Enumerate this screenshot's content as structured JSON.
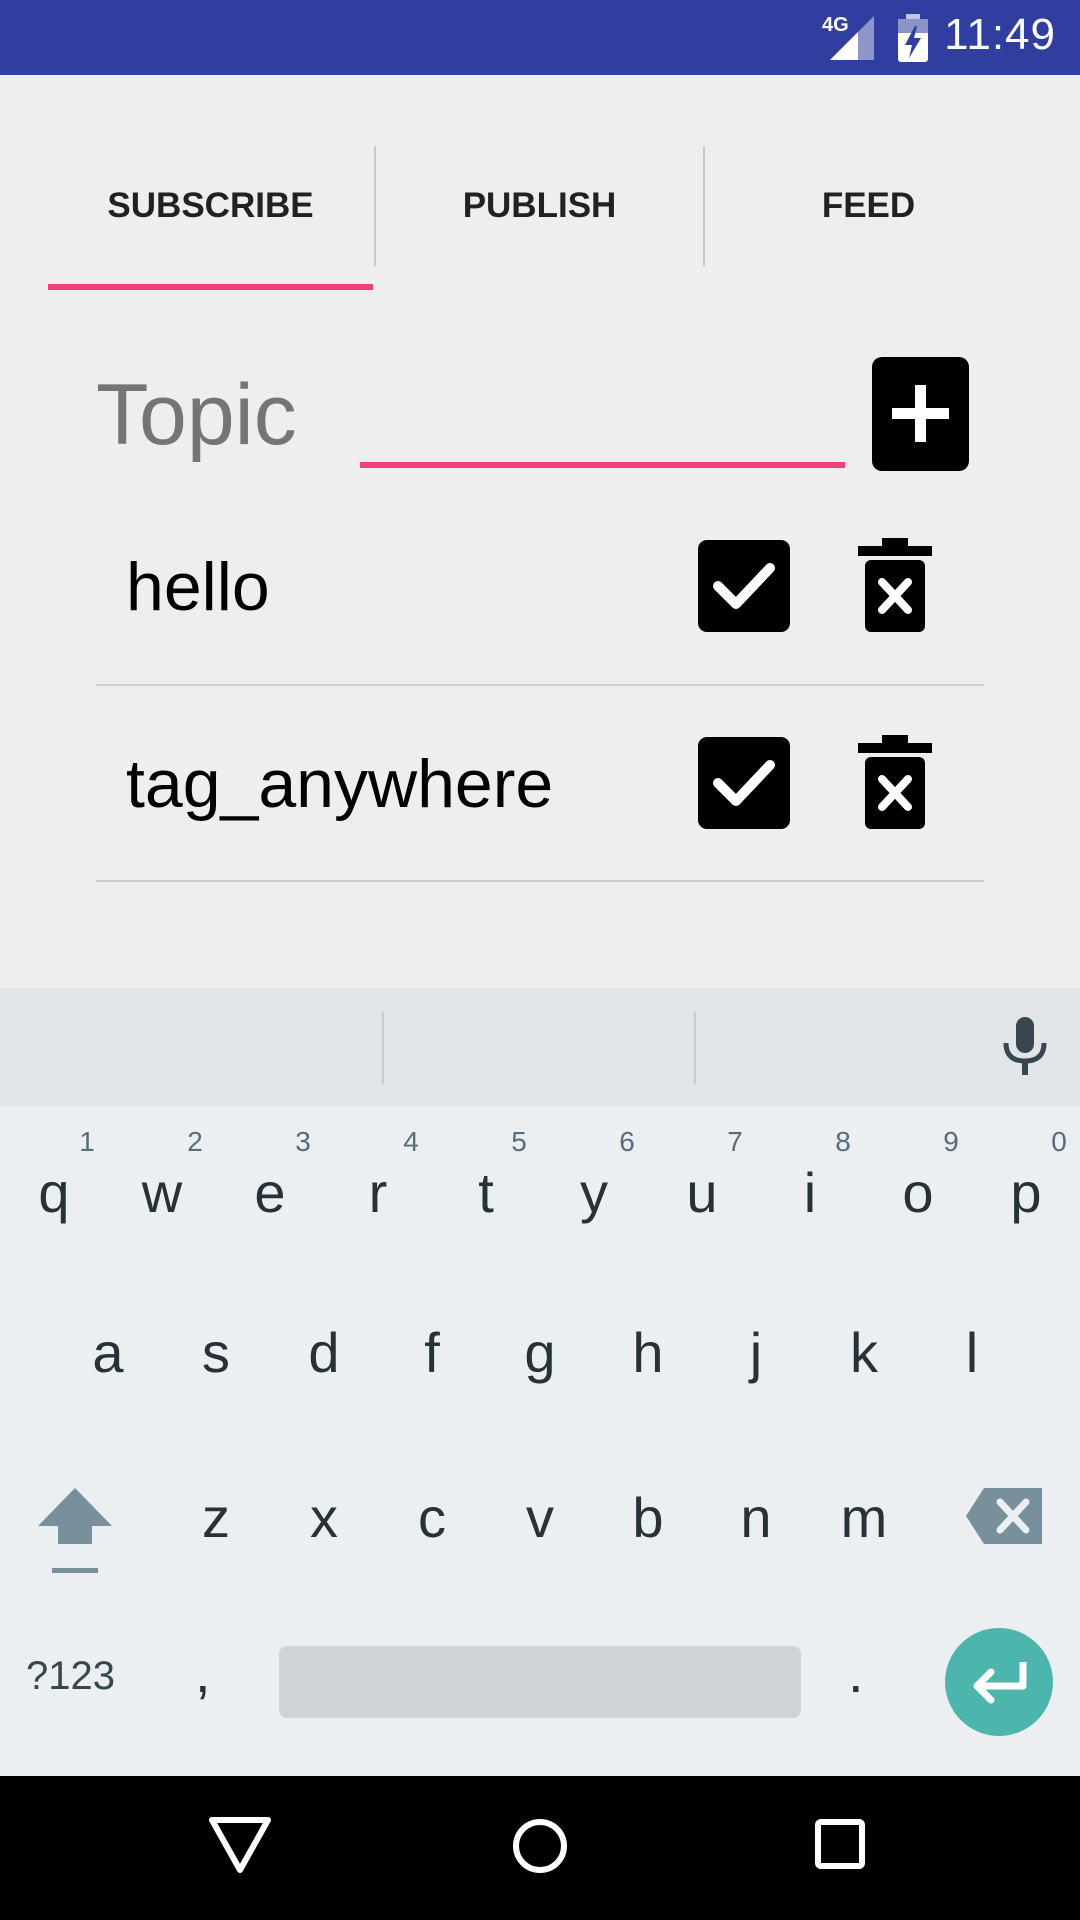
{
  "status_bar": {
    "time": "11:49",
    "network": "4G"
  },
  "tabs": [
    {
      "label": "SUBSCRIBE",
      "selected": true
    },
    {
      "label": "PUBLISH",
      "selected": false
    },
    {
      "label": "FEED",
      "selected": false
    }
  ],
  "topic": {
    "label": "Topic",
    "value": "",
    "accent_color": "#f0407a"
  },
  "subscriptions": [
    {
      "name": "hello",
      "checked": true
    },
    {
      "name": "tag_anywhere",
      "checked": true
    }
  ],
  "keyboard": {
    "row1": [
      {
        "key": "q",
        "hint": "1"
      },
      {
        "key": "w",
        "hint": "2"
      },
      {
        "key": "e",
        "hint": "3"
      },
      {
        "key": "r",
        "hint": "4"
      },
      {
        "key": "t",
        "hint": "5"
      },
      {
        "key": "y",
        "hint": "6"
      },
      {
        "key": "u",
        "hint": "7"
      },
      {
        "key": "i",
        "hint": "8"
      },
      {
        "key": "o",
        "hint": "9"
      },
      {
        "key": "p",
        "hint": "0"
      }
    ],
    "row2": [
      "a",
      "s",
      "d",
      "f",
      "g",
      "h",
      "j",
      "k",
      "l"
    ],
    "row3": [
      "z",
      "x",
      "c",
      "v",
      "b",
      "n",
      "m"
    ],
    "symbols_label": "?123",
    "comma": ",",
    "period": ".",
    "enter_color": "#4db6ac"
  },
  "colors": {
    "status_bar": "#303f9f",
    "accent": "#f0407a",
    "background": "#eeeeee"
  }
}
